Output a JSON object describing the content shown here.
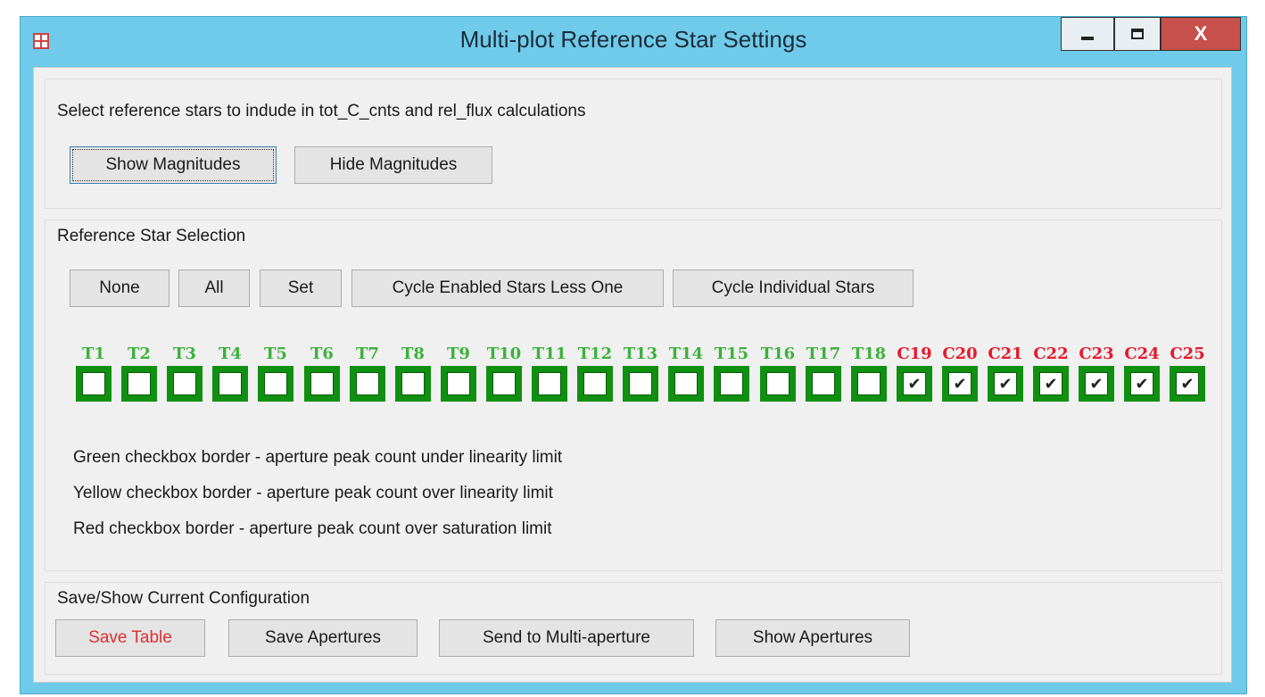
{
  "window": {
    "title": "Multi-plot Reference Star Settings",
    "close_glyph": "X"
  },
  "intro": {
    "text": "Select reference stars to indude in tot_C_cnts and rel_flux calculations",
    "show_magnitudes": "Show Magnitudes",
    "hide_magnitudes": "Hide Magnitudes"
  },
  "selection": {
    "heading": "Reference Star Selection",
    "buttons": [
      "None",
      "All",
      "Set",
      "Cycle Enabled Stars Less One",
      "Cycle Individual Stars"
    ],
    "stars": [
      {
        "label": "T1",
        "checked": false
      },
      {
        "label": "T2",
        "checked": false
      },
      {
        "label": "T3",
        "checked": false
      },
      {
        "label": "T4",
        "checked": false
      },
      {
        "label": "T5",
        "checked": false
      },
      {
        "label": "T6",
        "checked": false
      },
      {
        "label": "T7",
        "checked": false
      },
      {
        "label": "T8",
        "checked": false
      },
      {
        "label": "T9",
        "checked": false
      },
      {
        "label": "T10",
        "checked": false
      },
      {
        "label": "T11",
        "checked": false
      },
      {
        "label": "T12",
        "checked": false
      },
      {
        "label": "T13",
        "checked": false
      },
      {
        "label": "T14",
        "checked": false
      },
      {
        "label": "T15",
        "checked": false
      },
      {
        "label": "T16",
        "checked": false
      },
      {
        "label": "T17",
        "checked": false
      },
      {
        "label": "T18",
        "checked": false
      },
      {
        "label": "C19",
        "checked": true
      },
      {
        "label": "C20",
        "checked": true
      },
      {
        "label": "C21",
        "checked": true
      },
      {
        "label": "C22",
        "checked": true
      },
      {
        "label": "C23",
        "checked": true
      },
      {
        "label": "C24",
        "checked": true
      },
      {
        "label": "C25",
        "checked": true
      }
    ],
    "legend": [
      "Green checkbox border - aperture peak count under linearity limit",
      "Yellow checkbox border - aperture peak count over linearity limit",
      "Red checkbox border - aperture peak count over saturation limit"
    ]
  },
  "save": {
    "heading": "Save/Show Current Configuration",
    "save_table": "Save Table",
    "save_apertures": "Save Apertures",
    "send_multi": "Send to Multi-aperture",
    "show_apertures": "Show Apertures"
  },
  "colors": {
    "target_label": "#3db13d",
    "comparison_label": "#e8182b",
    "checkbox_border": "#109010"
  }
}
